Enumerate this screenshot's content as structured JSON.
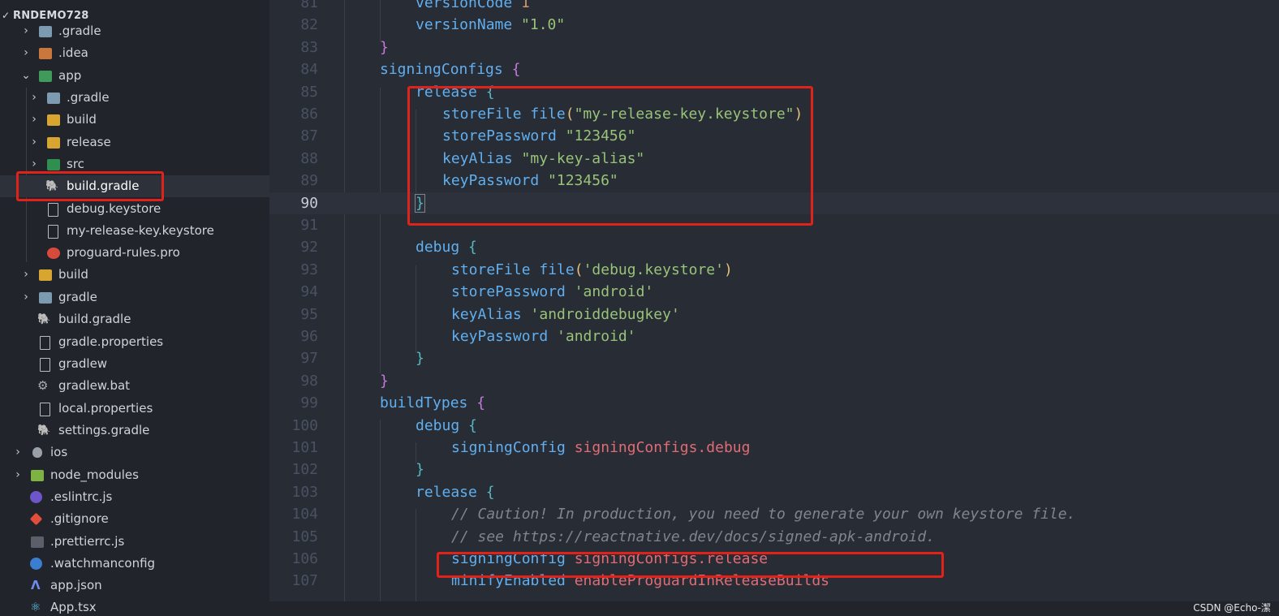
{
  "explorer": {
    "root_label": "RNDEMO728",
    "items": [
      {
        "label": ".gradle"
      },
      {
        "label": ".idea"
      },
      {
        "label": "app"
      },
      {
        "label": ".gradle"
      },
      {
        "label": "build"
      },
      {
        "label": "release"
      },
      {
        "label": "src"
      },
      {
        "label": "build.gradle"
      },
      {
        "label": "debug.keystore"
      },
      {
        "label": "my-release-key.keystore"
      },
      {
        "label": "proguard-rules.pro"
      },
      {
        "label": "build"
      },
      {
        "label": "gradle"
      },
      {
        "label": "build.gradle"
      },
      {
        "label": "gradle.properties"
      },
      {
        "label": "gradlew"
      },
      {
        "label": "gradlew.bat"
      },
      {
        "label": "local.properties"
      },
      {
        "label": "settings.gradle"
      },
      {
        "label": "ios"
      },
      {
        "label": "node_modules"
      },
      {
        "label": ".eslintrc.js"
      },
      {
        "label": ".gitignore"
      },
      {
        "label": ".prettierrc.js"
      },
      {
        "label": ".watchmanconfig"
      },
      {
        "label": "app.json"
      },
      {
        "label": "App.tsx"
      }
    ]
  },
  "editor": {
    "lines": [
      {
        "n": "81",
        "t": [
          "versionCode ",
          "1"
        ]
      },
      {
        "n": "82",
        "t": [
          "versionName ",
          "\"1.0\""
        ]
      },
      {
        "n": "83",
        "t": [
          "}"
        ]
      },
      {
        "n": "84",
        "t": [
          "signingConfigs ",
          "{"
        ]
      },
      {
        "n": "85",
        "t": [
          "release ",
          "{"
        ]
      },
      {
        "n": "86",
        "t": [
          "storeFile ",
          "file",
          "(",
          "\"my-release-key.keystore\"",
          ")"
        ]
      },
      {
        "n": "87",
        "t": [
          "storePassword ",
          "\"123456\""
        ]
      },
      {
        "n": "88",
        "t": [
          "keyAlias ",
          "\"my-key-alias\""
        ]
      },
      {
        "n": "89",
        "t": [
          "keyPassword ",
          "\"123456\""
        ]
      },
      {
        "n": "90",
        "t": [
          "}"
        ]
      },
      {
        "n": "91",
        "t": []
      },
      {
        "n": "92",
        "t": [
          "debug ",
          "{"
        ]
      },
      {
        "n": "93",
        "t": [
          "storeFile ",
          "file",
          "(",
          "'debug.keystore'",
          ")"
        ]
      },
      {
        "n": "94",
        "t": [
          "storePassword ",
          "'android'"
        ]
      },
      {
        "n": "95",
        "t": [
          "keyAlias ",
          "'androiddebugkey'"
        ]
      },
      {
        "n": "96",
        "t": [
          "keyPassword ",
          "'android'"
        ]
      },
      {
        "n": "97",
        "t": [
          "}"
        ]
      },
      {
        "n": "98",
        "t": [
          "}"
        ]
      },
      {
        "n": "99",
        "t": [
          "buildTypes ",
          "{"
        ]
      },
      {
        "n": "100",
        "t": [
          "debug ",
          "{"
        ]
      },
      {
        "n": "101",
        "t": [
          "signingConfig ",
          "signingConfigs.debug"
        ]
      },
      {
        "n": "102",
        "t": [
          "}"
        ]
      },
      {
        "n": "103",
        "t": [
          "release ",
          "{"
        ]
      },
      {
        "n": "104",
        "t": [
          "// Caution! In production, you need to generate your own keystore file."
        ]
      },
      {
        "n": "105",
        "t": [
          "// see https://reactnative.dev/docs/signed-apk-android."
        ]
      },
      {
        "n": "106",
        "t": [
          "signingConfig ",
          "signingConfigs.release"
        ]
      },
      {
        "n": "107",
        "t": [
          "minifyEnabled ",
          "enableProguardInReleaseBuilds"
        ]
      }
    ]
  },
  "watermark": "CSDN @Echo-潔",
  "colors": {
    "highlight_box": "#e1221b",
    "keyword": "#61afef",
    "string": "#98c379",
    "reference": "#e06c75"
  }
}
